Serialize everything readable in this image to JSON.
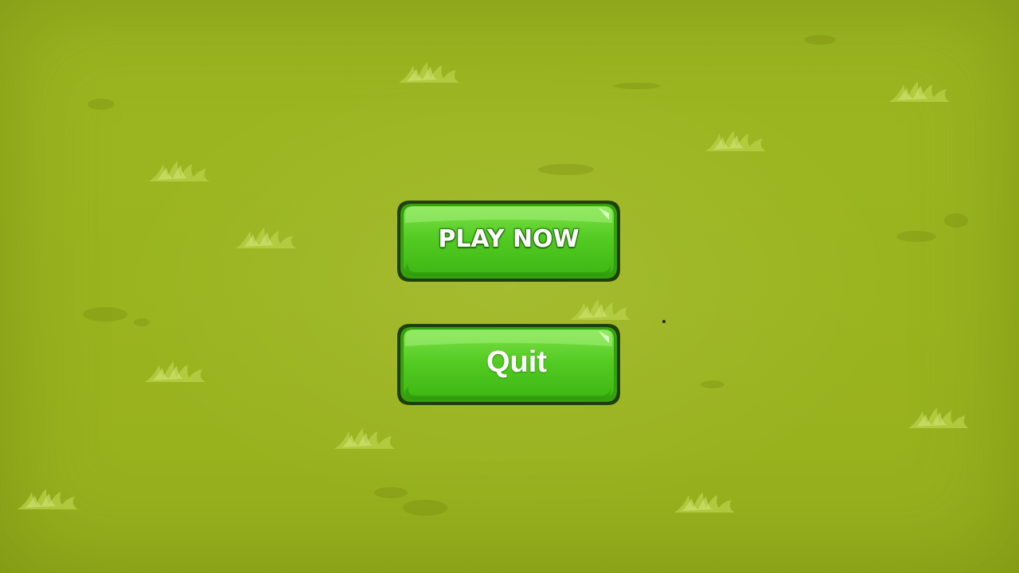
{
  "menu": {
    "play_label": "PLAY NOW",
    "quit_label": "Quit"
  },
  "colors": {
    "background": "#9cb621",
    "button_fill": "#4dc81f",
    "button_highlight": "#8ae85a",
    "button_outline": "#1f3f0c",
    "label": "#ffffff"
  },
  "icons": [
    "grass-tuft-icon"
  ]
}
